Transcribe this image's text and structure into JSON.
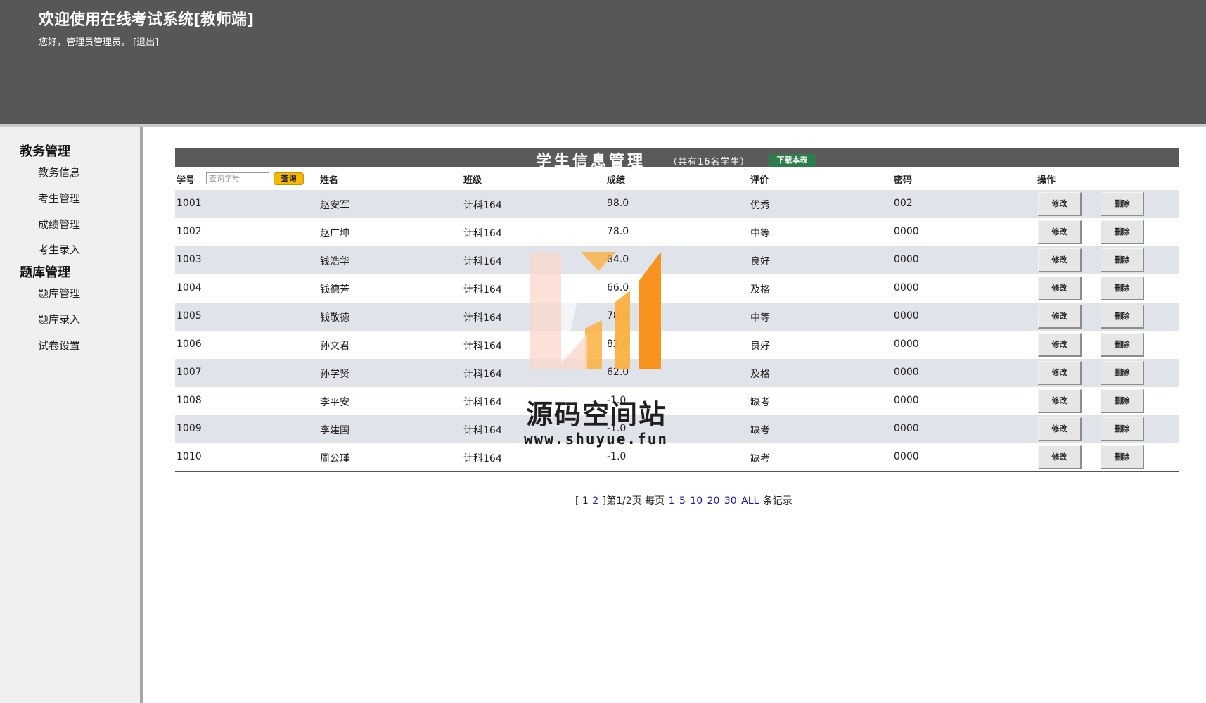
{
  "header": {
    "title": "欢迎使用在线考试系统[教师端]",
    "greeting": "您好，管理员管理员。",
    "logout_label": "[退出]"
  },
  "sidebar": {
    "groups": [
      {
        "label": "教务管理",
        "items": [
          "教务信息",
          "考生管理",
          "成绩管理",
          "考生录入"
        ]
      },
      {
        "label": "题库管理",
        "items": [
          "题库管理",
          "题库录入",
          "试卷设置"
        ]
      }
    ]
  },
  "table": {
    "title": "学生信息管理",
    "count_text": "（共有16名学生）",
    "download_label": "下载本表",
    "columns": [
      "学号",
      "姓名",
      "班级",
      "成绩",
      "评价",
      "密码",
      "操作"
    ],
    "search_placeholder": "查询学号",
    "search_button": "查询",
    "edit_label": "修改",
    "delete_label": "删除",
    "rows": [
      {
        "id": "1001",
        "name": "赵安军",
        "class": "计科164",
        "score": "98.0",
        "eval": "优秀",
        "password": "002"
      },
      {
        "id": "1002",
        "name": "赵广坤",
        "class": "计科164",
        "score": "78.0",
        "eval": "中等",
        "password": "0000"
      },
      {
        "id": "1003",
        "name": "钱浩华",
        "class": "计科164",
        "score": "84.0",
        "eval": "良好",
        "password": "0000"
      },
      {
        "id": "1004",
        "name": "钱德芳",
        "class": "计科164",
        "score": "66.0",
        "eval": "及格",
        "password": "0000"
      },
      {
        "id": "1005",
        "name": "钱敬德",
        "class": "计科164",
        "score": "78.0",
        "eval": "中等",
        "password": "0000"
      },
      {
        "id": "1006",
        "name": "孙文君",
        "class": "计科164",
        "score": "82.0",
        "eval": "良好",
        "password": "0000"
      },
      {
        "id": "1007",
        "name": "孙学贤",
        "class": "计科164",
        "score": "62.0",
        "eval": "及格",
        "password": "0000"
      },
      {
        "id": "1008",
        "name": "李平安",
        "class": "计科164",
        "score": "-1.0",
        "eval": "缺考",
        "password": "0000"
      },
      {
        "id": "1009",
        "name": "李建国",
        "class": "计科164",
        "score": "-1.0",
        "eval": "缺考",
        "password": "0000"
      },
      {
        "id": "1010",
        "name": "周公瑾",
        "class": "计科164",
        "score": "-1.0",
        "eval": "缺考",
        "password": "0000"
      }
    ]
  },
  "pager": {
    "open": "[ 1",
    "page2": "2",
    "close_info": "]第1/2页 每页",
    "sizes": [
      "1",
      "5",
      "10",
      "20",
      "30",
      "ALL"
    ],
    "suffix": "条记录"
  },
  "watermark": {
    "text": "源码空间站",
    "url": "www.shuyue.fun",
    "colors": [
      "#f7931e",
      "#fbb040",
      "#f9d7c9"
    ]
  }
}
